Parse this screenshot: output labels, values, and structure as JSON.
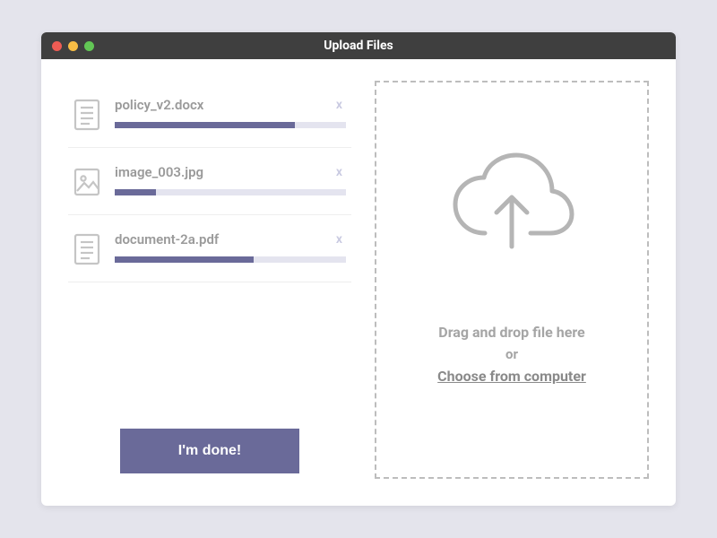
{
  "titlebar": {
    "title": "Upload Files"
  },
  "files": [
    {
      "name": "policy_v2.docx",
      "icon": "document",
      "progress": 78,
      "remove_label": "x"
    },
    {
      "name": "image_003.jpg",
      "icon": "image",
      "progress": 18,
      "remove_label": "x"
    },
    {
      "name": "document-2a.pdf",
      "icon": "document",
      "progress": 60,
      "remove_label": "x"
    }
  ],
  "done_button": {
    "label": "I'm done!"
  },
  "drop_zone": {
    "primary_text": "Drag and drop file here",
    "or_text": "or",
    "choose_text": "Choose from computer"
  },
  "colors": {
    "accent": "#6a6a99",
    "progress_track": "#e4e4ef"
  }
}
